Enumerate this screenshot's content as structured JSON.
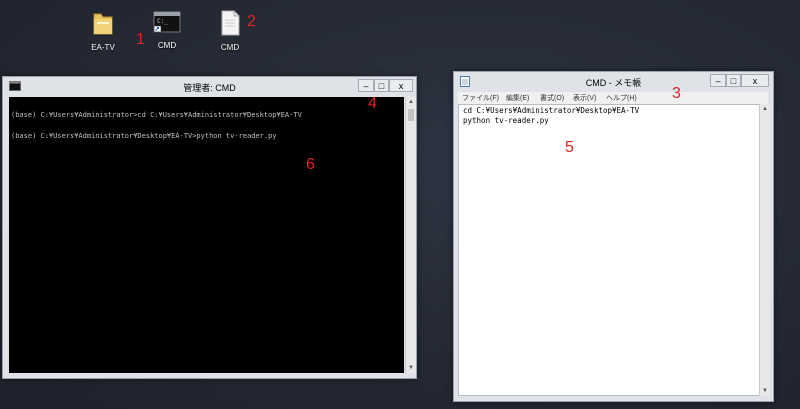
{
  "desktop": {
    "icons": [
      {
        "label": "EA-TV",
        "icon": "folder-icon"
      },
      {
        "label": "CMD",
        "icon": "cmd-shortcut-icon"
      },
      {
        "label": "CMD",
        "icon": "text-file-icon"
      }
    ],
    "annotations": [
      "1",
      "2",
      "3",
      "4",
      "5",
      "6"
    ],
    "annotation_color": "#e02424"
  },
  "cmd_window": {
    "title": "管理者: CMD",
    "buttons": {
      "minimize": "‒",
      "maximize": "□",
      "close": "x"
    },
    "lines": [
      "(base) C:¥Users¥Administrator>cd C:¥Users¥Administrator¥Desktop¥EA-TV",
      "(base) C:¥Users¥Administrator¥Desktop¥EA-TV>python tv-reader.py"
    ]
  },
  "notepad_window": {
    "title": "CMD - メモ帳",
    "buttons": {
      "minimize": "‒",
      "maximize": "□",
      "close": "x"
    },
    "menu": [
      "ファイル(F)",
      "編集(E)",
      "書式(O)",
      "表示(V)",
      "ヘルプ(H)"
    ],
    "lines": [
      "cd C:¥Users¥Administrator¥Desktop¥EA-TV",
      "python tv-reader.py"
    ]
  }
}
